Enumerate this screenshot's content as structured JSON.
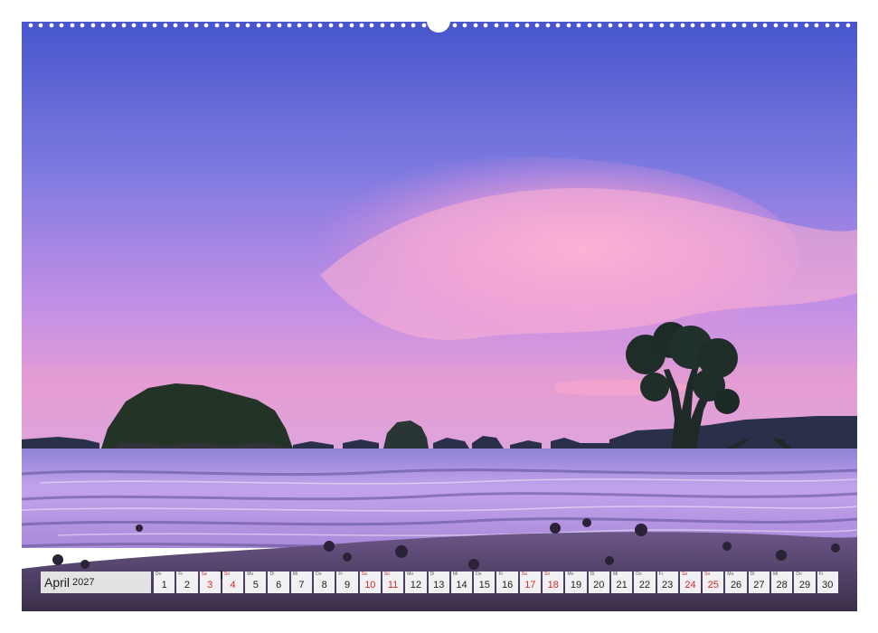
{
  "calendar": {
    "month": "April",
    "year": "2027",
    "days": [
      {
        "wd": "Do",
        "num": "1",
        "weekend": false
      },
      {
        "wd": "Fr",
        "num": "2",
        "weekend": false
      },
      {
        "wd": "Sa",
        "num": "3",
        "weekend": true
      },
      {
        "wd": "So",
        "num": "4",
        "weekend": true
      },
      {
        "wd": "Mo",
        "num": "5",
        "weekend": false
      },
      {
        "wd": "Di",
        "num": "6",
        "weekend": false
      },
      {
        "wd": "Mi",
        "num": "7",
        "weekend": false
      },
      {
        "wd": "Do",
        "num": "8",
        "weekend": false
      },
      {
        "wd": "Fr",
        "num": "9",
        "weekend": false
      },
      {
        "wd": "Sa",
        "num": "10",
        "weekend": true
      },
      {
        "wd": "So",
        "num": "11",
        "weekend": true
      },
      {
        "wd": "Mo",
        "num": "12",
        "weekend": false
      },
      {
        "wd": "Di",
        "num": "13",
        "weekend": false
      },
      {
        "wd": "Mi",
        "num": "14",
        "weekend": false
      },
      {
        "wd": "Do",
        "num": "15",
        "weekend": false
      },
      {
        "wd": "Fr",
        "num": "16",
        "weekend": false
      },
      {
        "wd": "Sa",
        "num": "17",
        "weekend": true
      },
      {
        "wd": "So",
        "num": "18",
        "weekend": true
      },
      {
        "wd": "Mo",
        "num": "19",
        "weekend": false
      },
      {
        "wd": "Di",
        "num": "20",
        "weekend": false
      },
      {
        "wd": "Mi",
        "num": "21",
        "weekend": false
      },
      {
        "wd": "Do",
        "num": "22",
        "weekend": false
      },
      {
        "wd": "Fr",
        "num": "23",
        "weekend": false
      },
      {
        "wd": "Sa",
        "num": "24",
        "weekend": true
      },
      {
        "wd": "So",
        "num": "25",
        "weekend": true
      },
      {
        "wd": "Mo",
        "num": "26",
        "weekend": false
      },
      {
        "wd": "Di",
        "num": "27",
        "weekend": false
      },
      {
        "wd": "Mi",
        "num": "28",
        "weekend": false
      },
      {
        "wd": "Do",
        "num": "29",
        "weekend": false
      },
      {
        "wd": "Fr",
        "num": "30",
        "weekend": false
      }
    ]
  },
  "colors": {
    "weekend": "#d22a2a",
    "sky_top": "#4a5fd0",
    "sky_mid": "#9b7fe0",
    "sky_horizon": "#e9a3d6",
    "cloud_pink": "#f5a8d8",
    "water": "#b89ae6",
    "silhouette": "#1f2a38"
  }
}
